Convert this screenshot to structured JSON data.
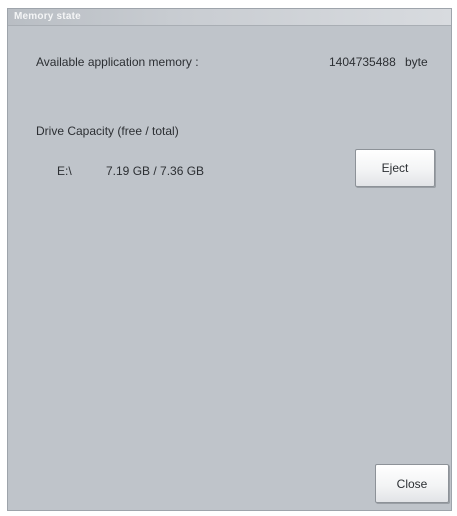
{
  "window": {
    "title": "Memory state"
  },
  "memory": {
    "label": "Available application memory :",
    "value": "1404735488",
    "unit": "byte"
  },
  "drive": {
    "header": "Drive Capacity (free / total)",
    "items": [
      {
        "letter": "E:\\",
        "capacity": "7.19 GB / 7.36 GB",
        "action_label": "Eject"
      }
    ]
  },
  "footer": {
    "close_label": "Close"
  }
}
